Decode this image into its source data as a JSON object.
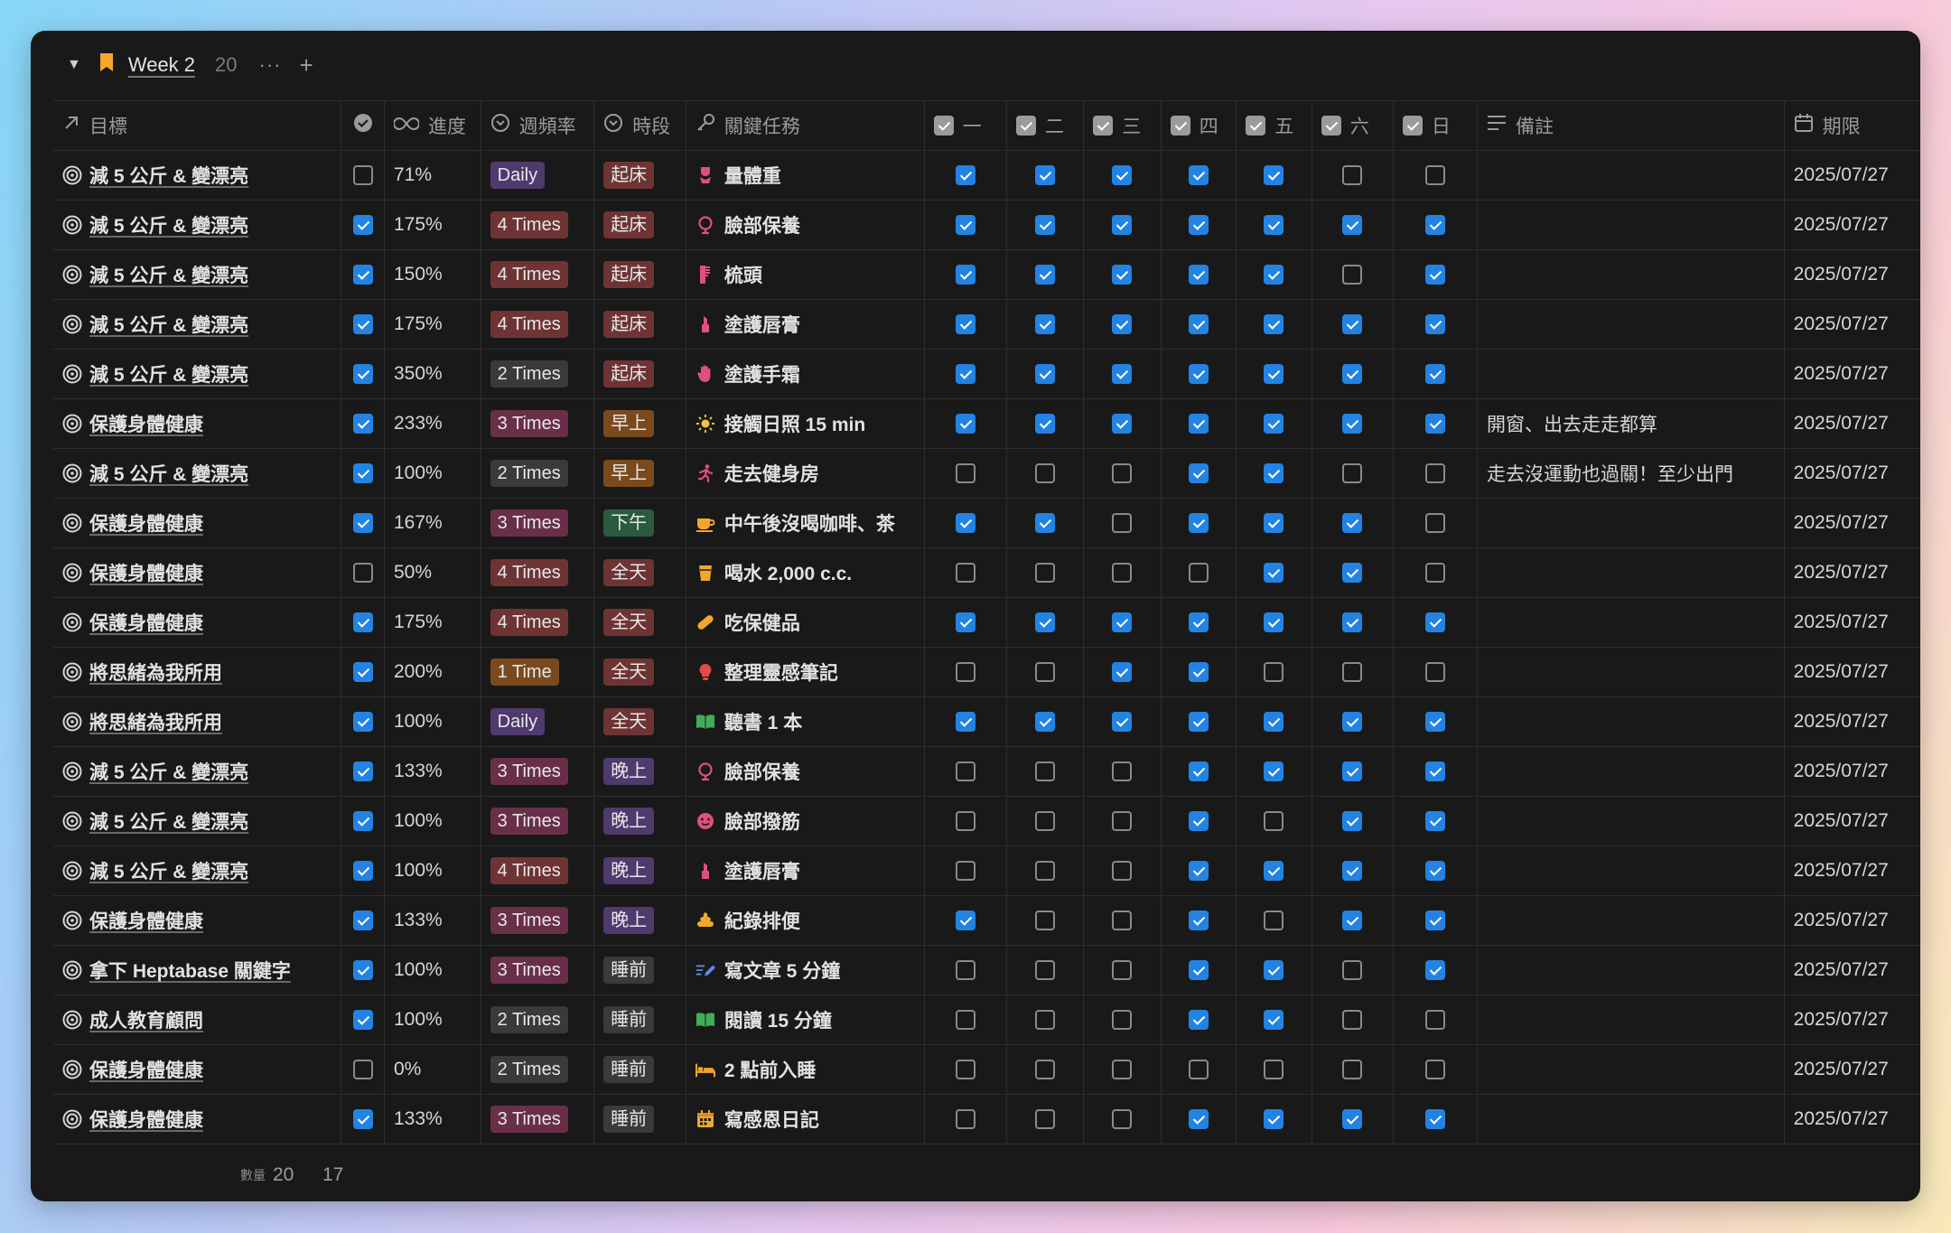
{
  "group": {
    "title": "Week 2",
    "count": "20",
    "more_label": "···",
    "add_label": "+"
  },
  "columns": {
    "goal": "目標",
    "progress": "進度",
    "frequency": "週頻率",
    "period": "時段",
    "task": "關鍵任務",
    "days": [
      "一",
      "二",
      "三",
      "四",
      "五",
      "六",
      "日"
    ],
    "note": "備註",
    "deadline": "期限"
  },
  "tag_colors": {
    "Daily": "#4f3a6e",
    "4 Times": "#6e3434",
    "2 Times": "#3a3a3a",
    "3 Times": "#6a2f48",
    "1 Time": "#7a4a1e",
    "起床": "#6e3434",
    "早上": "#7a4a1e",
    "下午": "#2b5b3f",
    "全天": "#6e3434",
    "晚上": "#4f3a6e",
    "睡前": "#3a3a3a"
  },
  "rows": [
    {
      "goal": "減 5 公斤 & 變漂亮",
      "done": false,
      "progress": "71%",
      "freq": "Daily",
      "period": "起床",
      "task_icon": "swimsuit-icon",
      "task": "量體重",
      "days": [
        true,
        true,
        true,
        true,
        true,
        false,
        false
      ],
      "note": "",
      "deadline": "2025/07/27"
    },
    {
      "goal": "減 5 公斤 & 變漂亮",
      "done": true,
      "progress": "175%",
      "freq": "4 Times",
      "period": "起床",
      "task_icon": "mirror-icon",
      "task": "臉部保養",
      "days": [
        true,
        true,
        true,
        true,
        true,
        true,
        true
      ],
      "note": "",
      "deadline": "2025/07/27"
    },
    {
      "goal": "減 5 公斤 & 變漂亮",
      "done": true,
      "progress": "150%",
      "freq": "4 Times",
      "period": "起床",
      "task_icon": "comb-icon",
      "task": "梳頭",
      "days": [
        true,
        true,
        true,
        true,
        true,
        false,
        true
      ],
      "note": "",
      "deadline": "2025/07/27"
    },
    {
      "goal": "減 5 公斤 & 變漂亮",
      "done": true,
      "progress": "175%",
      "freq": "4 Times",
      "period": "起床",
      "task_icon": "lipstick-icon",
      "task": "塗護唇膏",
      "days": [
        true,
        true,
        true,
        true,
        true,
        true,
        true
      ],
      "note": "",
      "deadline": "2025/07/27"
    },
    {
      "goal": "減 5 公斤 & 變漂亮",
      "done": true,
      "progress": "350%",
      "freq": "2 Times",
      "period": "起床",
      "task_icon": "hand-icon",
      "task": "塗護手霜",
      "days": [
        true,
        true,
        true,
        true,
        true,
        true,
        true
      ],
      "note": "",
      "deadline": "2025/07/27"
    },
    {
      "goal": "保護身體健康",
      "done": true,
      "progress": "233%",
      "freq": "3 Times",
      "period": "早上",
      "task_icon": "sun-icon",
      "task": "接觸日照 15 min",
      "days": [
        true,
        true,
        true,
        true,
        true,
        true,
        true
      ],
      "note": "開窗、出去走走都算",
      "deadline": "2025/07/27"
    },
    {
      "goal": "減 5 公斤 & 變漂亮",
      "done": true,
      "progress": "100%",
      "freq": "2 Times",
      "period": "早上",
      "task_icon": "running-icon",
      "task": "走去健身房",
      "days": [
        false,
        false,
        false,
        true,
        true,
        false,
        false
      ],
      "note": "走去沒運動也過關！至少出門",
      "deadline": "2025/07/27"
    },
    {
      "goal": "保護身體健康",
      "done": true,
      "progress": "167%",
      "freq": "3 Times",
      "period": "下午",
      "task_icon": "coffee-icon",
      "task": "中午後沒喝咖啡、茶",
      "days": [
        true,
        true,
        false,
        true,
        true,
        true,
        false
      ],
      "note": "",
      "deadline": "2025/07/27"
    },
    {
      "goal": "保護身體健康",
      "done": false,
      "progress": "50%",
      "freq": "4 Times",
      "period": "全天",
      "task_icon": "cup-icon",
      "task": "喝水 2,000 c.c.",
      "days": [
        false,
        false,
        false,
        false,
        true,
        true,
        false
      ],
      "note": "",
      "deadline": "2025/07/27"
    },
    {
      "goal": "保護身體健康",
      "done": true,
      "progress": "175%",
      "freq": "4 Times",
      "period": "全天",
      "task_icon": "pill-icon",
      "task": "吃保健品",
      "days": [
        true,
        true,
        true,
        true,
        true,
        true,
        true
      ],
      "note": "",
      "deadline": "2025/07/27"
    },
    {
      "goal": "將思緒為我所用",
      "done": true,
      "progress": "200%",
      "freq": "1 Time",
      "period": "全天",
      "task_icon": "lightbulb-icon",
      "task": "整理靈感筆記",
      "days": [
        false,
        false,
        true,
        true,
        false,
        false,
        false
      ],
      "note": "",
      "deadline": "2025/07/27"
    },
    {
      "goal": "將思緒為我所用",
      "done": true,
      "progress": "100%",
      "freq": "Daily",
      "period": "全天",
      "task_icon": "book-icon",
      "task": "聽書 1 本",
      "days": [
        true,
        true,
        true,
        true,
        true,
        true,
        true
      ],
      "note": "",
      "deadline": "2025/07/27"
    },
    {
      "goal": "減 5 公斤 & 變漂亮",
      "done": true,
      "progress": "133%",
      "freq": "3 Times",
      "period": "晚上",
      "task_icon": "mirror-icon",
      "task": "臉部保養",
      "days": [
        false,
        false,
        false,
        true,
        true,
        true,
        true
      ],
      "note": "",
      "deadline": "2025/07/27"
    },
    {
      "goal": "減 5 公斤 & 變漂亮",
      "done": true,
      "progress": "100%",
      "freq": "3 Times",
      "period": "晚上",
      "task_icon": "face-icon",
      "task": "臉部撥筋",
      "days": [
        false,
        false,
        false,
        true,
        false,
        true,
        true
      ],
      "note": "",
      "deadline": "2025/07/27"
    },
    {
      "goal": "減 5 公斤 & 變漂亮",
      "done": true,
      "progress": "100%",
      "freq": "4 Times",
      "period": "晚上",
      "task_icon": "lipstick-icon",
      "task": "塗護唇膏",
      "days": [
        false,
        false,
        false,
        true,
        true,
        true,
        true
      ],
      "note": "",
      "deadline": "2025/07/27"
    },
    {
      "goal": "保護身體健康",
      "done": true,
      "progress": "133%",
      "freq": "3 Times",
      "period": "晚上",
      "task_icon": "poop-icon",
      "task": "紀錄排便",
      "days": [
        true,
        false,
        false,
        true,
        false,
        true,
        true
      ],
      "note": "",
      "deadline": "2025/07/27"
    },
    {
      "goal": "拿下 Heptabase 關鍵字",
      "done": true,
      "progress": "100%",
      "freq": "3 Times",
      "period": "睡前",
      "task_icon": "writing-icon",
      "task": "寫文章 5 分鐘",
      "days": [
        false,
        false,
        false,
        true,
        true,
        false,
        true
      ],
      "note": "",
      "deadline": "2025/07/27"
    },
    {
      "goal": "成人教育顧問",
      "done": true,
      "progress": "100%",
      "freq": "2 Times",
      "period": "睡前",
      "task_icon": "book-icon",
      "task": "閱讀 15 分鐘",
      "days": [
        false,
        false,
        false,
        true,
        true,
        false,
        false
      ],
      "note": "",
      "deadline": "2025/07/27"
    },
    {
      "goal": "保護身體健康",
      "done": false,
      "progress": "0%",
      "freq": "2 Times",
      "period": "睡前",
      "task_icon": "bed-icon",
      "task": "2 點前入睡",
      "days": [
        false,
        false,
        false,
        false,
        false,
        false,
        false
      ],
      "note": "",
      "deadline": "2025/07/27"
    },
    {
      "goal": "保護身體健康",
      "done": true,
      "progress": "133%",
      "freq": "3 Times",
      "period": "睡前",
      "task_icon": "calendar-icon",
      "task": "寫感恩日記",
      "days": [
        false,
        false,
        false,
        true,
        true,
        true,
        true
      ],
      "note": "",
      "deadline": "2025/07/27"
    }
  ],
  "footer": {
    "count_label": "數量",
    "count_value": "20",
    "checked_value": "17"
  }
}
